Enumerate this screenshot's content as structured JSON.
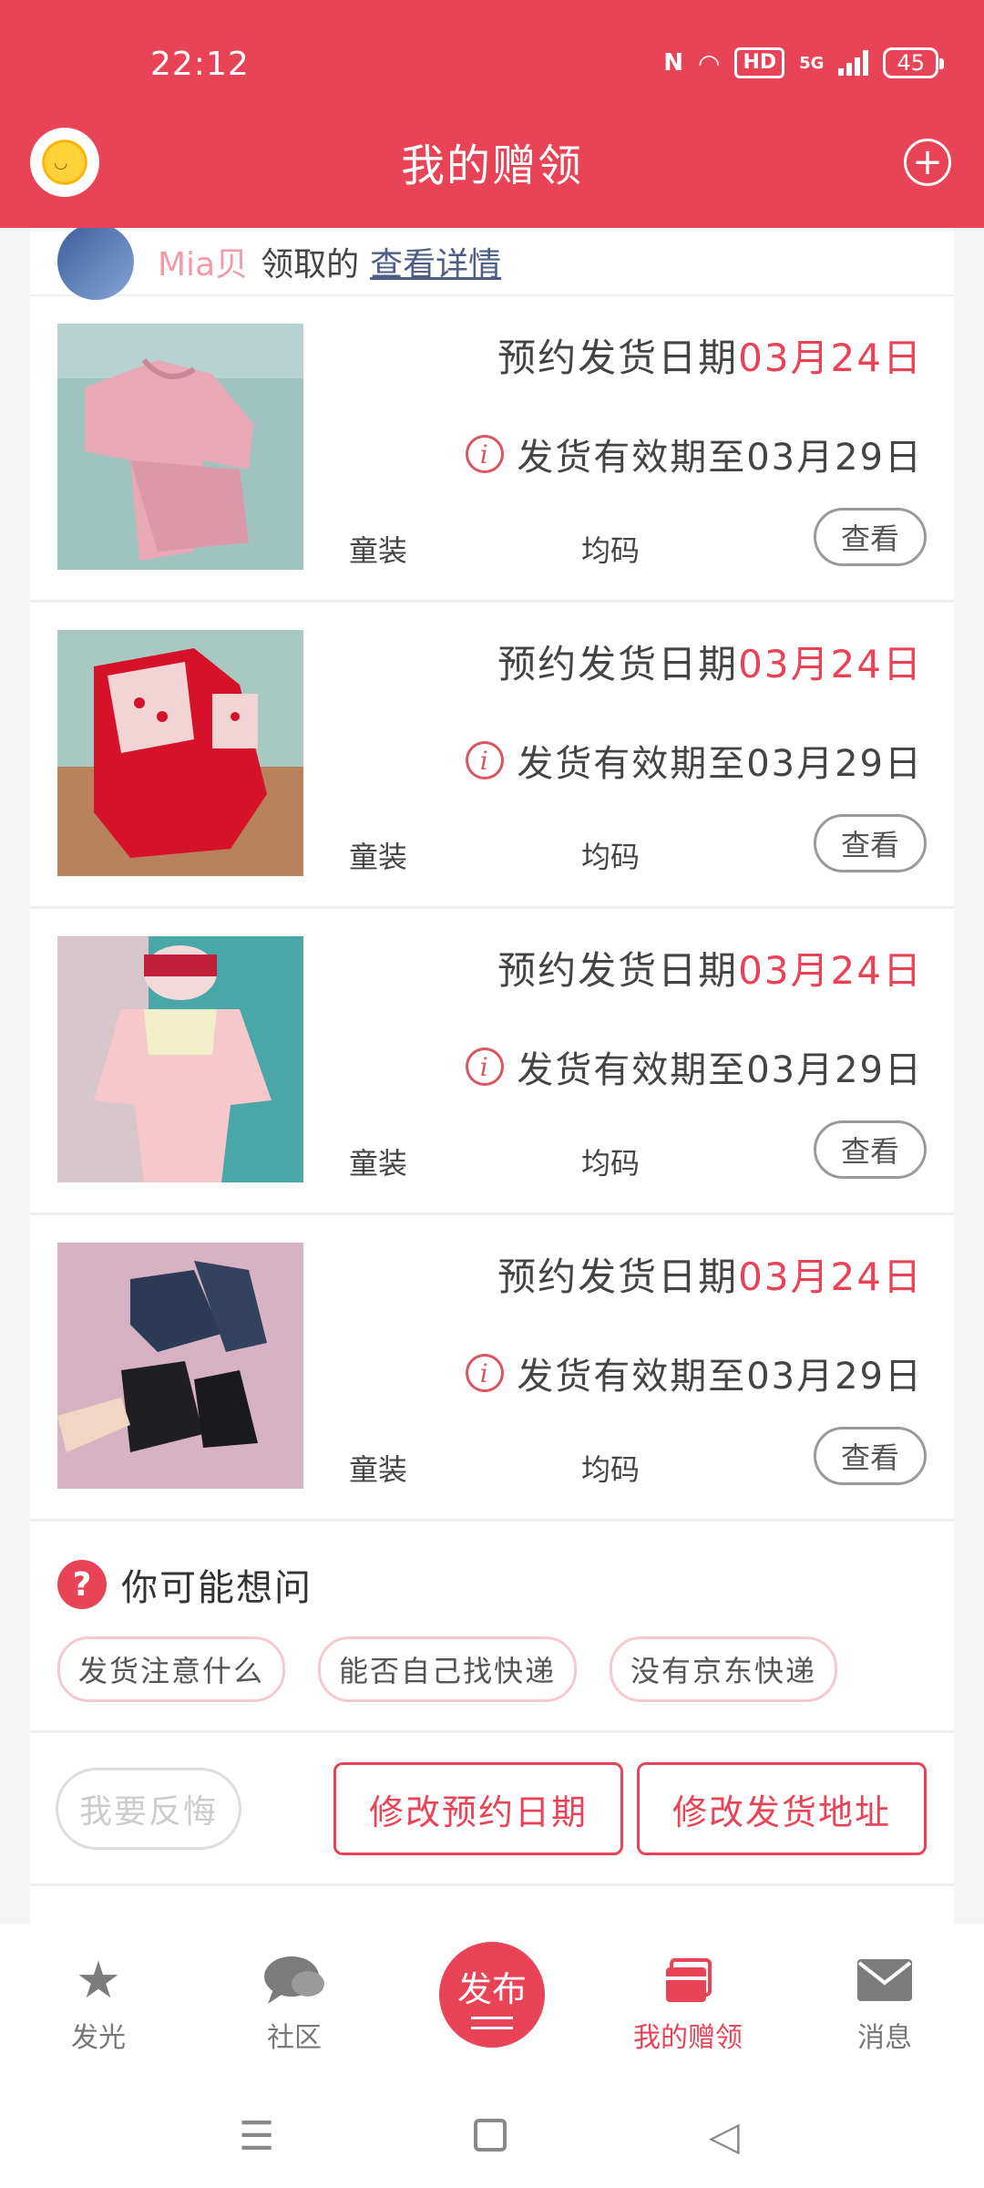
{
  "status": {
    "time": "22:12",
    "battery": "45",
    "hd": "HD",
    "network": "5G"
  },
  "header": {
    "title": "我的赠领"
  },
  "receiver": {
    "name": "Mia贝",
    "action": "领取的",
    "link": "查看详情"
  },
  "items": [
    {
      "ship_label": "预约发货日期",
      "ship_date": "03月24日",
      "valid_text": "发货有效期至03月29日",
      "category": "童装",
      "size": "均码",
      "view": "查看"
    },
    {
      "ship_label": "预约发货日期",
      "ship_date": "03月24日",
      "valid_text": "发货有效期至03月29日",
      "category": "童装",
      "size": "均码",
      "view": "查看"
    },
    {
      "ship_label": "预约发货日期",
      "ship_date": "03月24日",
      "valid_text": "发货有效期至03月29日",
      "category": "童装",
      "size": "均码",
      "view": "查看"
    },
    {
      "ship_label": "预约发货日期",
      "ship_date": "03月24日",
      "valid_text": "发货有效期至03月29日",
      "category": "童装",
      "size": "均码",
      "view": "查看"
    }
  ],
  "faq": {
    "title": "你可能想问",
    "tags": [
      "发货注意什么",
      "能否自己找快递",
      "没有京东快递"
    ]
  },
  "actions": {
    "regret": "我要反悔",
    "edit_date": "修改预约日期",
    "edit_address": "修改发货地址"
  },
  "nav": {
    "items": [
      {
        "label": "发光",
        "icon": "star-icon"
      },
      {
        "label": "社区",
        "icon": "chat-icon"
      },
      {
        "label": "我的赠领",
        "icon": "gift-icon"
      },
      {
        "label": "消息",
        "icon": "mail-icon"
      }
    ],
    "publish": "发布"
  },
  "colors": {
    "brand": "#e84357",
    "highlight": "#e84357"
  }
}
